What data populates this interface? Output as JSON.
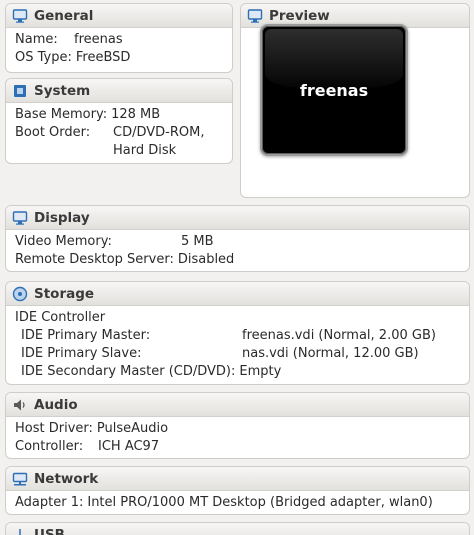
{
  "general": {
    "title": "General",
    "name_label": "Name:",
    "name_value": "freenas",
    "os_label": "OS Type:",
    "os_value": "FreeBSD"
  },
  "preview": {
    "title": "Preview",
    "screen_text": "freenas"
  },
  "system": {
    "title": "System",
    "memory_label": "Base Memory:",
    "memory_value": "128 MB",
    "boot_label": "Boot Order:",
    "boot_value_1": "CD/DVD-ROM,",
    "boot_value_2": "Hard Disk"
  },
  "display": {
    "title": "Display",
    "video_label": "Video Memory:",
    "video_value": "5 MB",
    "rds_label": "Remote Desktop Server:",
    "rds_value": "Disabled"
  },
  "storage": {
    "title": "Storage",
    "controller": "IDE Controller",
    "primary_master_label": "IDE Primary Master:",
    "primary_master_value": "freenas.vdi (Normal, 2.00 GB)",
    "primary_slave_label": "IDE Primary Slave:",
    "primary_slave_value": "nas.vdi (Normal, 12.00 GB)",
    "secondary_master_label": "IDE Secondary Master (CD/DVD):",
    "secondary_master_value": "Empty"
  },
  "audio": {
    "title": "Audio",
    "host_label": "Host Driver:",
    "host_value": "PulseAudio",
    "controller_label": "Controller:",
    "controller_value": "ICH AC97"
  },
  "network": {
    "title": "Network",
    "adapter_label": "Adapter 1:",
    "adapter_value": "Intel PRO/1000 MT Desktop (Bridged adapter, wlan0)"
  },
  "usb": {
    "title": "USB"
  },
  "colors": {
    "panel_bg": "#ffffff",
    "window_bg": "#f2f1f0",
    "icon_blue": "#2d6fb5"
  }
}
